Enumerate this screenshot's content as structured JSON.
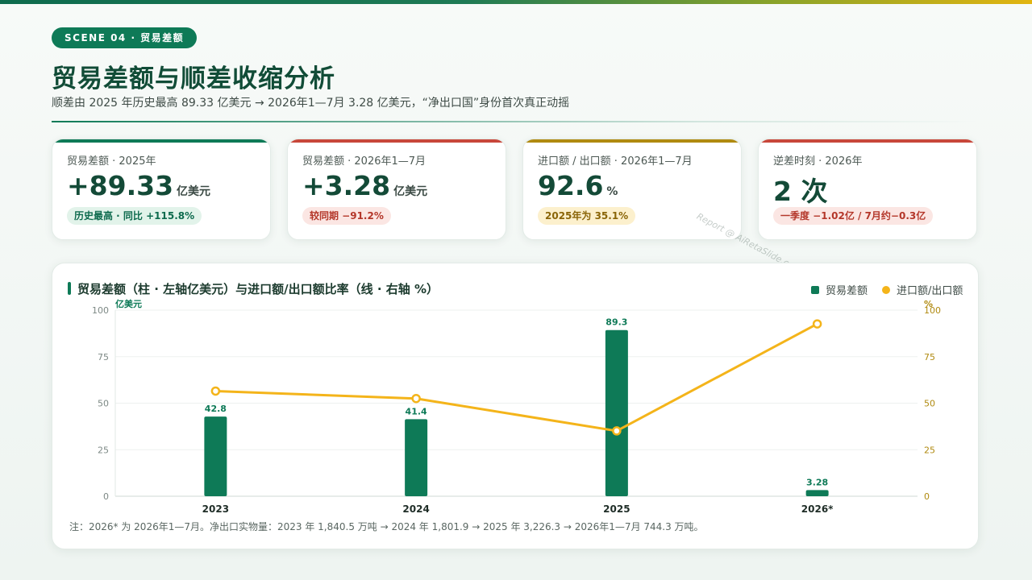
{
  "scene_label": "SCENE 04 · 贸易差额",
  "title": "贸易差额与顺差收缩分析",
  "subtitle": "顺差由 2025 年历史最高 89.33 亿美元 → 2026年1—7月 3.28 亿美元，“净出口国”身份首次真正动摇",
  "kpis": [
    {
      "label": "贸易差额 · 2025年",
      "value": "+89.33",
      "unit": "亿美元",
      "tag": "历史最高 · 同比 +115.8%",
      "accent": "#0e7a57"
    },
    {
      "label": "贸易差额 · 2026年1—7月",
      "value": "+3.28",
      "unit": "亿美元",
      "tag": "较同期 −91.2%",
      "accent": "#c8473a"
    },
    {
      "label": "进口额 / 出口额 · 2026年1—7月",
      "value": "92.6",
      "unit": "%",
      "tag": "2025年为 35.1%",
      "accent": "#b08a10"
    },
    {
      "label": "逆差时刻 · 2026年",
      "value": "2 次",
      "unit": "",
      "tag": "一季度 −1.02亿 / 7月约−0.3亿",
      "accent": "#c8473a"
    }
  ],
  "watermark": "Report @ AiRetaSlide.com",
  "chart": {
    "title": "贸易差额（柱 · 左轴亿美元）与进口额/出口额比率（线 · 右轴 %）",
    "legend": [
      "贸易差额",
      "进口额/出口额"
    ],
    "left_unit": "亿美元",
    "right_unit": "%"
  },
  "chart_data": {
    "type": "bar",
    "categories": [
      "2023",
      "2024",
      "2025",
      "2026*"
    ],
    "series": [
      {
        "name": "贸易差额",
        "type": "bar",
        "axis": "left",
        "values": [
          42.8,
          41.4,
          89.3,
          3.28
        ],
        "labels": [
          "42.8",
          "41.4",
          "89.3",
          "3.28"
        ],
        "color": "#0e7a57"
      },
      {
        "name": "进口额/出口额",
        "type": "line",
        "axis": "right",
        "values": [
          56.5,
          52.5,
          35.1,
          92.6
        ],
        "color": "#f4b41a"
      }
    ],
    "ylabel": "亿美元",
    "ylabel_right": "%",
    "ylim": [
      0,
      100
    ],
    "ylim_right": [
      0,
      100
    ],
    "yticks": [
      "0",
      "25",
      "50",
      "75",
      "100"
    ],
    "yticks_right": [
      "0",
      "25",
      "50",
      "75",
      "100"
    ],
    "grid": true,
    "legend_position": "top-right"
  },
  "footnote": "注：2026* 为 2026年1—7月。净出口实物量：2023 年 1,840.5 万吨 → 2024 年 1,801.9 → 2025 年 3,226.3 → 2026年1—7月 744.3 万吨。",
  "colors": {
    "primary": "#0e7a57",
    "line": "#f4b41a",
    "red": "#c8473a",
    "gold": "#b08a10"
  }
}
